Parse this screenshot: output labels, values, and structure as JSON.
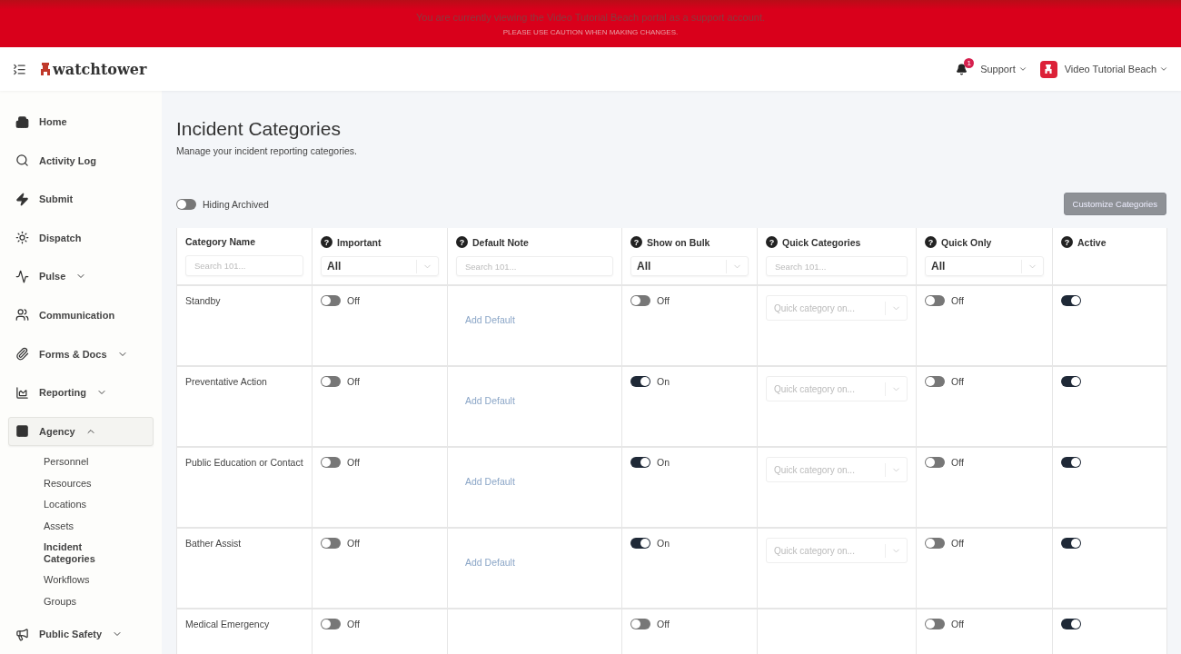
{
  "banner": {
    "message": "You are currently viewing the Video Tutorial Beach portal as a support account.",
    "caution": "PLEASE USE CAUTION WHEN MAKING CHANGES."
  },
  "header": {
    "logo": "watchtower",
    "notifications": "1",
    "support": "Support",
    "account": "Video Tutorial Beach"
  },
  "sidebar": {
    "items": [
      {
        "label": "Home",
        "selected": false
      },
      {
        "label": "Activity Log",
        "selected": false
      },
      {
        "label": "Submit",
        "selected": false
      },
      {
        "label": "Dispatch",
        "selected": false
      },
      {
        "label": "Pulse",
        "expanded": false,
        "selected": false
      },
      {
        "label": "Communication",
        "selected": false
      },
      {
        "label": "Forms & Docs",
        "expanded": false,
        "selected": false
      },
      {
        "label": "Reporting",
        "expanded": false,
        "selected": false
      },
      {
        "label": "Agency",
        "expanded": true,
        "selected": true,
        "children": [
          {
            "label": "Personnel",
            "selected": false
          },
          {
            "label": "Resources",
            "selected": false
          },
          {
            "label": "Locations",
            "selected": false
          },
          {
            "label": "Assets",
            "selected": false
          },
          {
            "label": "Incident Categories",
            "selected": true
          },
          {
            "label": "Workflows",
            "selected": false
          },
          {
            "label": "Groups",
            "selected": false
          }
        ]
      },
      {
        "label": "Public Safety",
        "expanded": false,
        "selected": false
      }
    ]
  },
  "page": {
    "title": "Incident Categories",
    "subtitle": "Manage your incident reporting categories.",
    "archived_toggle": {
      "label": "Hiding Archived",
      "on": false
    },
    "customize_button": "Customize Categories"
  },
  "table": {
    "columns": [
      {
        "label": "Category Name",
        "kind": "search",
        "placeholder": "Search 101..."
      },
      {
        "label": "Important",
        "help": "?",
        "kind": "select",
        "value": "All"
      },
      {
        "label": "Default Note",
        "help": "?",
        "kind": "search",
        "placeholder": "Search 101..."
      },
      {
        "label": "Show on Bulk",
        "help": "?",
        "kind": "select",
        "value": "All"
      },
      {
        "label": "Quick Categories",
        "help": "?",
        "kind": "search",
        "placeholder": "Search 101..."
      },
      {
        "label": "Quick Only",
        "help": "?",
        "kind": "select",
        "value": "All"
      },
      {
        "label": "Active",
        "help": "?",
        "kind": "plain"
      }
    ],
    "rows": [
      {
        "name": "Standby",
        "important": {
          "on": false,
          "label": "Off"
        },
        "default_note": "Add Default",
        "show_on_bulk": {
          "on": false,
          "label": "Off"
        },
        "quick_category": "Quick category on...",
        "quick_only": {
          "on": false,
          "label": "Off"
        },
        "active": true
      },
      {
        "name": "Preventative Action",
        "important": {
          "on": false,
          "label": "Off"
        },
        "default_note": "Add Default",
        "show_on_bulk": {
          "on": true,
          "label": "On"
        },
        "quick_category": "Quick category on...",
        "quick_only": {
          "on": false,
          "label": "Off"
        },
        "active": true
      },
      {
        "name": "Public Education or Contact",
        "important": {
          "on": false,
          "label": "Off"
        },
        "default_note": "Add Default",
        "show_on_bulk": {
          "on": true,
          "label": "On"
        },
        "quick_category": "Quick category on...",
        "quick_only": {
          "on": false,
          "label": "Off"
        },
        "active": true
      },
      {
        "name": "Bather Assist",
        "important": {
          "on": false,
          "label": "Off"
        },
        "default_note": "Add Default",
        "show_on_bulk": {
          "on": true,
          "label": "On"
        },
        "quick_category": "Quick category on...",
        "quick_only": {
          "on": false,
          "label": "Off"
        },
        "active": true
      },
      {
        "name": "Medical Emergency",
        "important": {
          "on": false,
          "label": "Off"
        },
        "show_on_bulk": {
          "on": false,
          "label": "Off"
        },
        "quick_only": {
          "on": false,
          "label": "Off"
        },
        "active": true
      }
    ]
  }
}
